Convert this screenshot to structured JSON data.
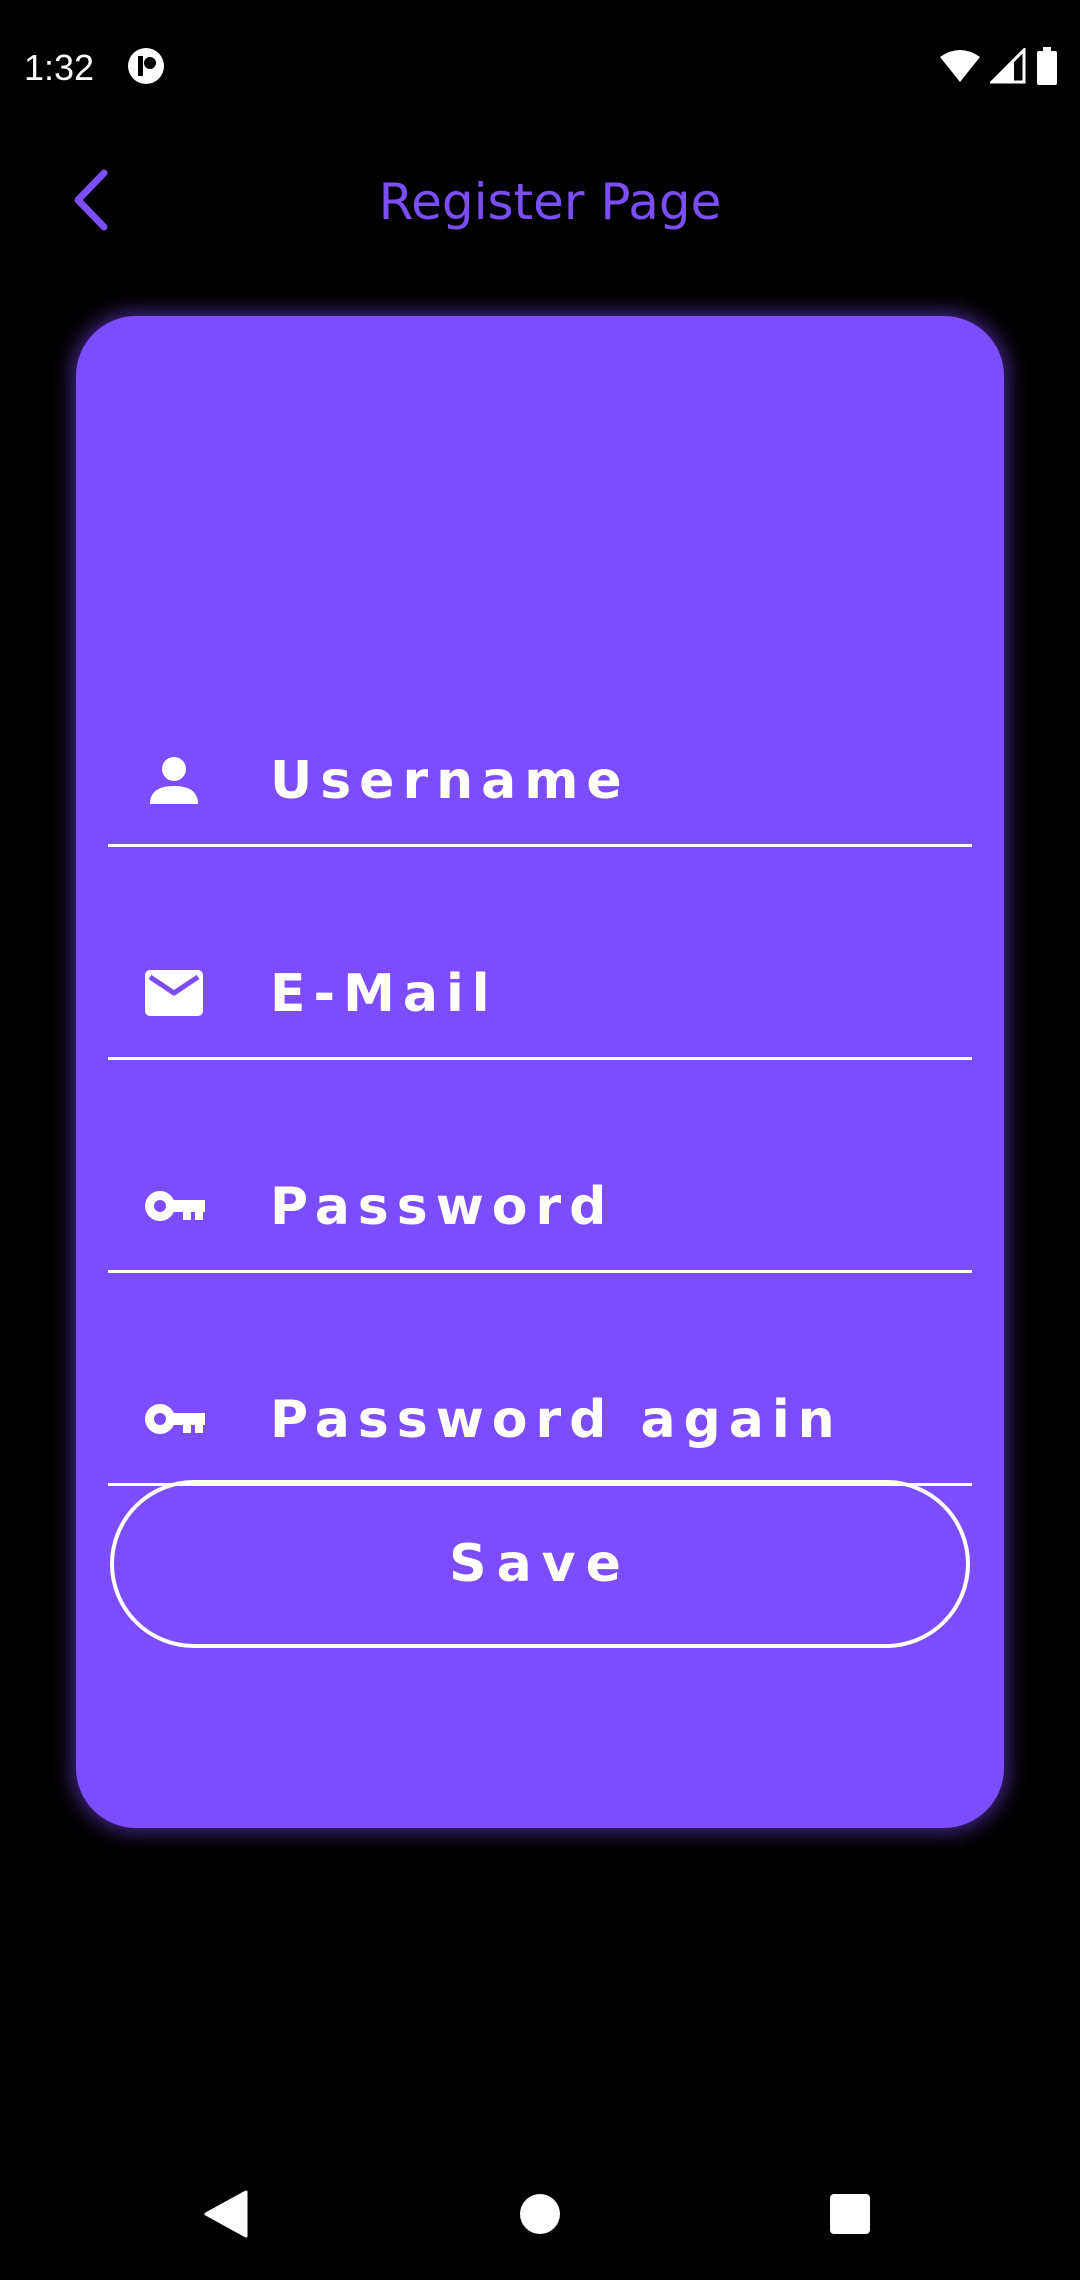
{
  "status_bar": {
    "time": "1:32"
  },
  "app_bar": {
    "title": "Register Page",
    "back_icon": "chevron-left-icon"
  },
  "form": {
    "fields": [
      {
        "icon": "person-icon",
        "placeholder": "Username"
      },
      {
        "icon": "mail-icon",
        "placeholder": "E-Mail"
      },
      {
        "icon": "key-icon",
        "placeholder": "Password"
      },
      {
        "icon": "key-icon",
        "placeholder": "Password again"
      }
    ],
    "save_label": "Save"
  },
  "colors": {
    "background": "#000000",
    "card": "#7c4dff",
    "title": "#7b4ff7",
    "text": "#ffffff"
  },
  "nav_bar": {
    "back_icon": "triangle-back-icon",
    "home_icon": "circle-home-icon",
    "recents_icon": "square-recents-icon"
  }
}
